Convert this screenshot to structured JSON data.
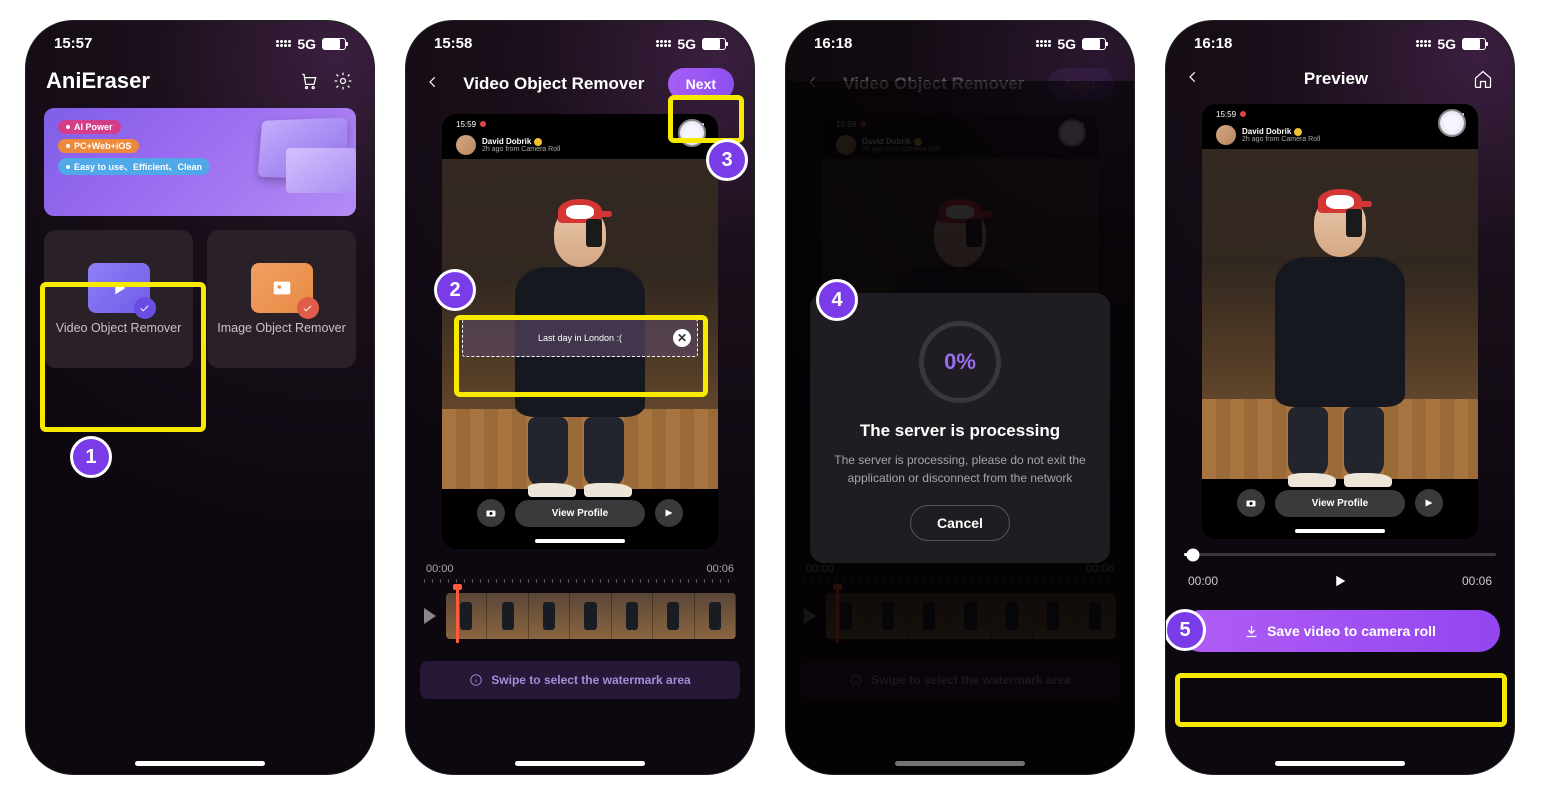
{
  "statusbar": {
    "time1": "15:57",
    "time2": "15:58",
    "time3": "16:18",
    "time4": "16:18",
    "network": "5G"
  },
  "home": {
    "appName": "AniEraser",
    "banner": {
      "line1": "AI Power",
      "line2": "PC+Web+iOS",
      "line3": "Easy to use、Efficient、Clean"
    },
    "tiles": {
      "video": "Video Object Remover",
      "image": "Image Object Remover"
    }
  },
  "editor": {
    "title": "Video Object Remover",
    "next": "Next",
    "miniTime": "15:59",
    "user": {
      "name": "David Dobrik",
      "sub": "2h ago from Camera Roll"
    },
    "caption": "Last day in London :(",
    "viewProfile": "View Profile",
    "timeStart": "00:00",
    "timeEnd": "00:06",
    "hint": "Swipe to select the watermark area"
  },
  "processing": {
    "percent": "0%",
    "title": "The server is processing",
    "body": "The server is processing, please do not exit the application or disconnect from the network",
    "cancel": "Cancel"
  },
  "preview": {
    "title": "Preview",
    "timeStart": "00:00",
    "timeEnd": "00:06",
    "save": "Save video to camera roll"
  },
  "steps": {
    "s1": "1",
    "s2": "2",
    "s3": "3",
    "s4": "4",
    "s5": "5"
  }
}
